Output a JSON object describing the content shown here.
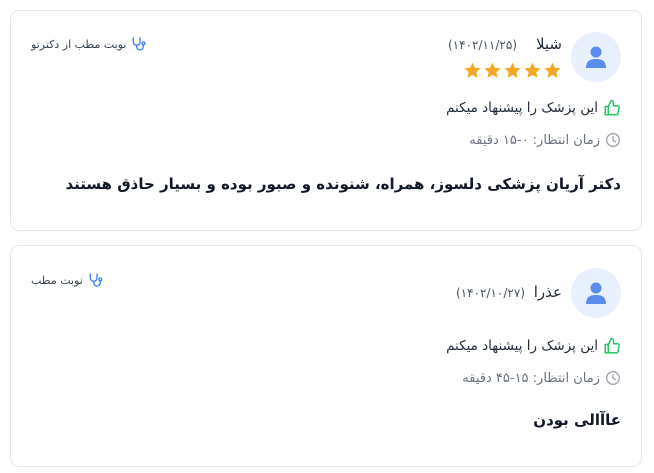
{
  "reviews": [
    {
      "name": "شیلا",
      "date": "(۱۴۰۲/۱۱/۲۵)",
      "rating": 5,
      "recommendation": "این پزشک را پیشنهاد میکنم",
      "wait_time": "زمان انتظار: ۰-۱۵ دقیقه",
      "comment": "دکتر آریان پزشکی دلسوز، همراه، شنونده و صبور بوده و بسیار حاذق هستند",
      "appointment_type": "نوبت مطب از دکترتو"
    },
    {
      "name": "عذرا",
      "date": "(۱۴۰۲/۱۰/۲۷)",
      "recommendation": "این پزشک را پیشنهاد میکنم",
      "wait_time": "زمان انتظار: ۱۵-۴۵ دقیقه",
      "comment": "عاآالی بودن",
      "appointment_type": "نوبت مطب"
    }
  ],
  "colors": {
    "star": "#f5a623",
    "thumb": "#22c55e",
    "stethoscope": "#3b82f6",
    "avatar_bg": "#e8effd",
    "avatar_fg": "#5b8def"
  },
  "icons": {
    "avatar": "user-icon",
    "star": "star-icon",
    "recommend": "thumbs-up-icon",
    "wait": "clock-icon",
    "appointment": "stethoscope-icon"
  }
}
